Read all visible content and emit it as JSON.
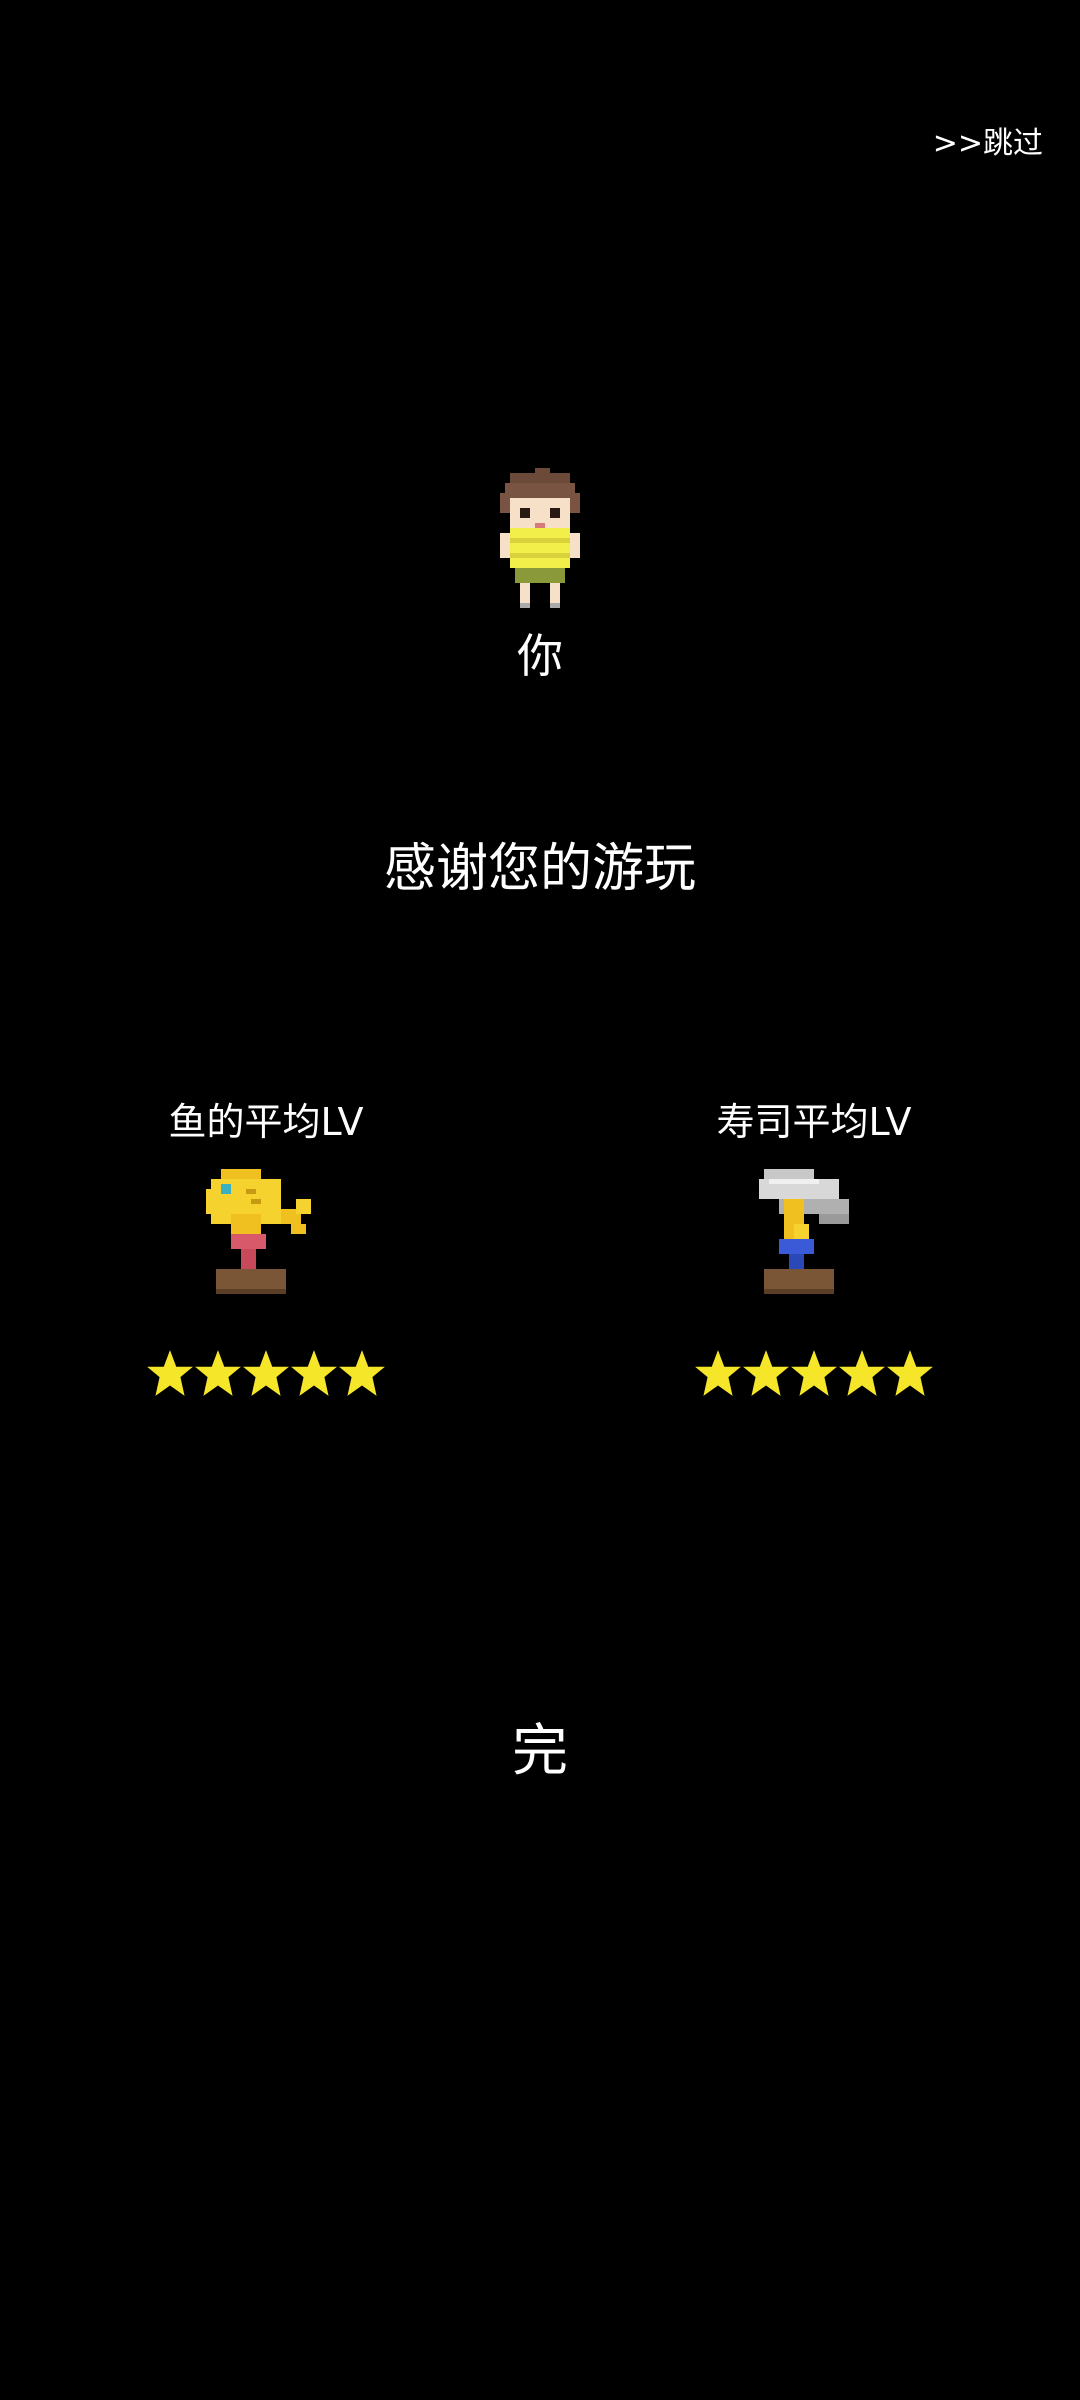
{
  "skip_label": ">>跳过",
  "player": {
    "label": "你",
    "icon": "boy-character-sprite"
  },
  "thanks_message": "感谢您的游玩",
  "stats": {
    "fish": {
      "label": "鱼的平均LV",
      "icon": "golden-fish-trophy",
      "stars": 5,
      "max_stars": 5
    },
    "sushi": {
      "label": "寿司平均LV",
      "icon": "sushi-trophy",
      "stars": 5,
      "max_stars": 5
    }
  },
  "end_label": "完",
  "colors": {
    "background": "#000000",
    "text": "#ffffff",
    "star": "#f5e62a",
    "gold": "#f0c020",
    "base": "#6b4a2a"
  }
}
